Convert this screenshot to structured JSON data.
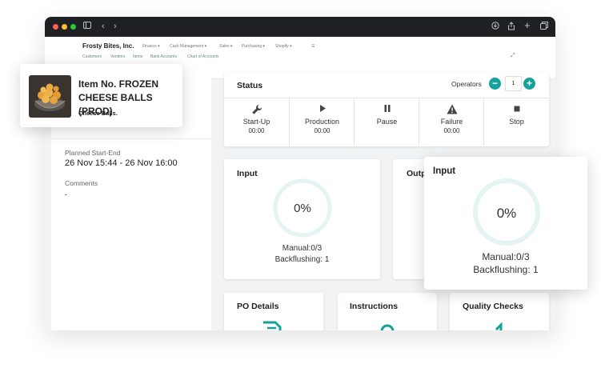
{
  "browser": {
    "icons": [
      "sidebar-icon",
      "back-icon",
      "forward-icon",
      "download-icon",
      "share-icon",
      "new-tab-icon",
      "tabs-icon"
    ]
  },
  "nav": {
    "company": "Frosty Bites, Inc.",
    "menus": [
      "Finance",
      "Cash Management",
      "Sales",
      "Purchasing",
      "Shopify"
    ],
    "links": [
      "Customers",
      "Vendors",
      "Items",
      "Bank Accounts",
      "Chart of Accounts"
    ]
  },
  "item": {
    "title": "Item No. FROZEN CHEESE BALLS (PROD)",
    "description": "Cheese Balls."
  },
  "details": {
    "planned_label": "Planned Start-End",
    "planned_value": "26 Nov 15:44 - 26 Nov 16:00",
    "comments_label": "Comments",
    "comments_value": "-"
  },
  "status": {
    "title": "Status",
    "operators_label": "Operators",
    "operators_count": "1",
    "buttons": [
      {
        "label": "Start-Up",
        "time": "00:00",
        "icon": "wrench-icon"
      },
      {
        "label": "Production",
        "time": "00:00",
        "icon": "play-icon"
      },
      {
        "label": "Pause",
        "time": "",
        "icon": "pause-icon"
      },
      {
        "label": "Failure",
        "time": "00:00",
        "icon": "warning-icon"
      },
      {
        "label": "Stop",
        "time": "",
        "icon": "stop-icon"
      }
    ]
  },
  "input_card": {
    "title": "Input",
    "percent_value": 0,
    "percent_text": "0%",
    "manual": "Manual:0/3",
    "backflushing": "Backflushing: 1"
  },
  "output_card": {
    "title_partial": "Outp"
  },
  "bottom_cards": {
    "po_details": "PO Details",
    "instructions": "Instructions",
    "quality_checks": "Quality Checks"
  },
  "colors": {
    "accent": "#14a39a",
    "gauge_track": "#e3f4f3",
    "titlebar": "#1f2024"
  }
}
